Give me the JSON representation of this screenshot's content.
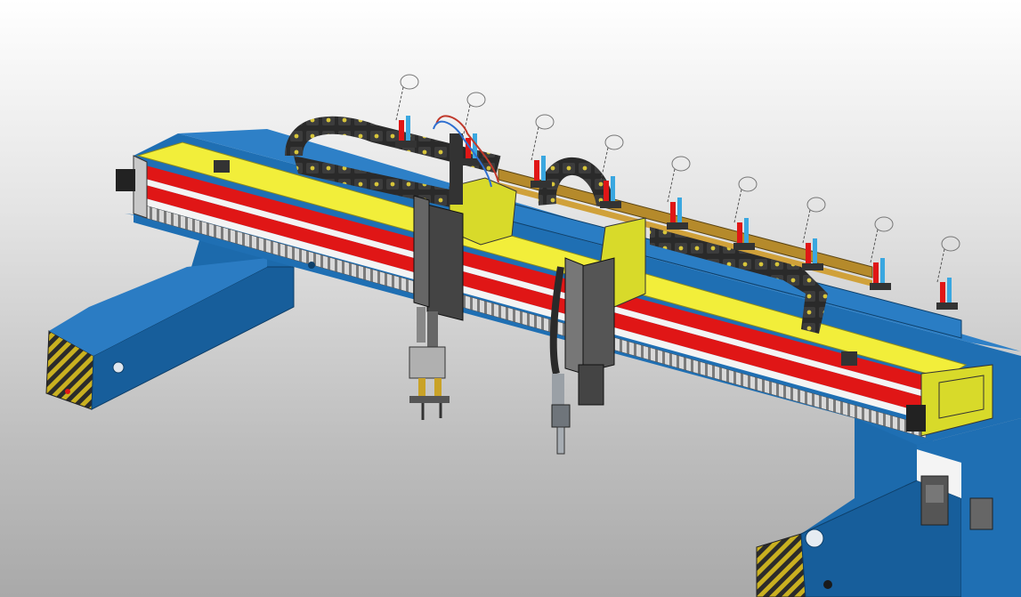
{
  "viewport": {
    "background_top": "#ffffff",
    "background_bottom": "#a9a9a9"
  },
  "model": {
    "colors": {
      "frame_blue": "#1f6fb3",
      "frame_blue_dark": "#0f4f86",
      "rail_red": "#e01616",
      "rail_yellow": "#f2ee3a",
      "carriage_yellow": "#d8da2a",
      "cable_chain": "#2a2a2a",
      "hazard_yellow": "#c9b020",
      "steel": "#8a8f95"
    },
    "torch_heads": 2,
    "valve_posts": 9
  }
}
